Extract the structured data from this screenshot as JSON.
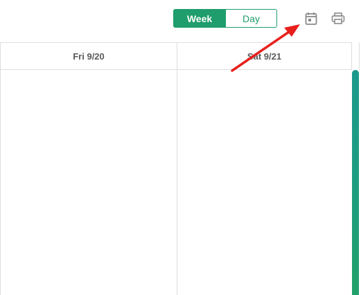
{
  "toolbar": {
    "view_toggle": {
      "week_label": "Week",
      "day_label": "Day",
      "selected": "Week"
    },
    "calendar_icon": "calendar-icon",
    "print_icon": "print-icon"
  },
  "week_grid": {
    "columns": [
      {
        "label": "Fri 9/20"
      },
      {
        "label": "Sat 9/21"
      }
    ]
  },
  "colors": {
    "accent": "#1f9d6c",
    "annotation_arrow": "#e8201c",
    "grid_line": "#dedede",
    "header_text": "#5a5a5a"
  }
}
